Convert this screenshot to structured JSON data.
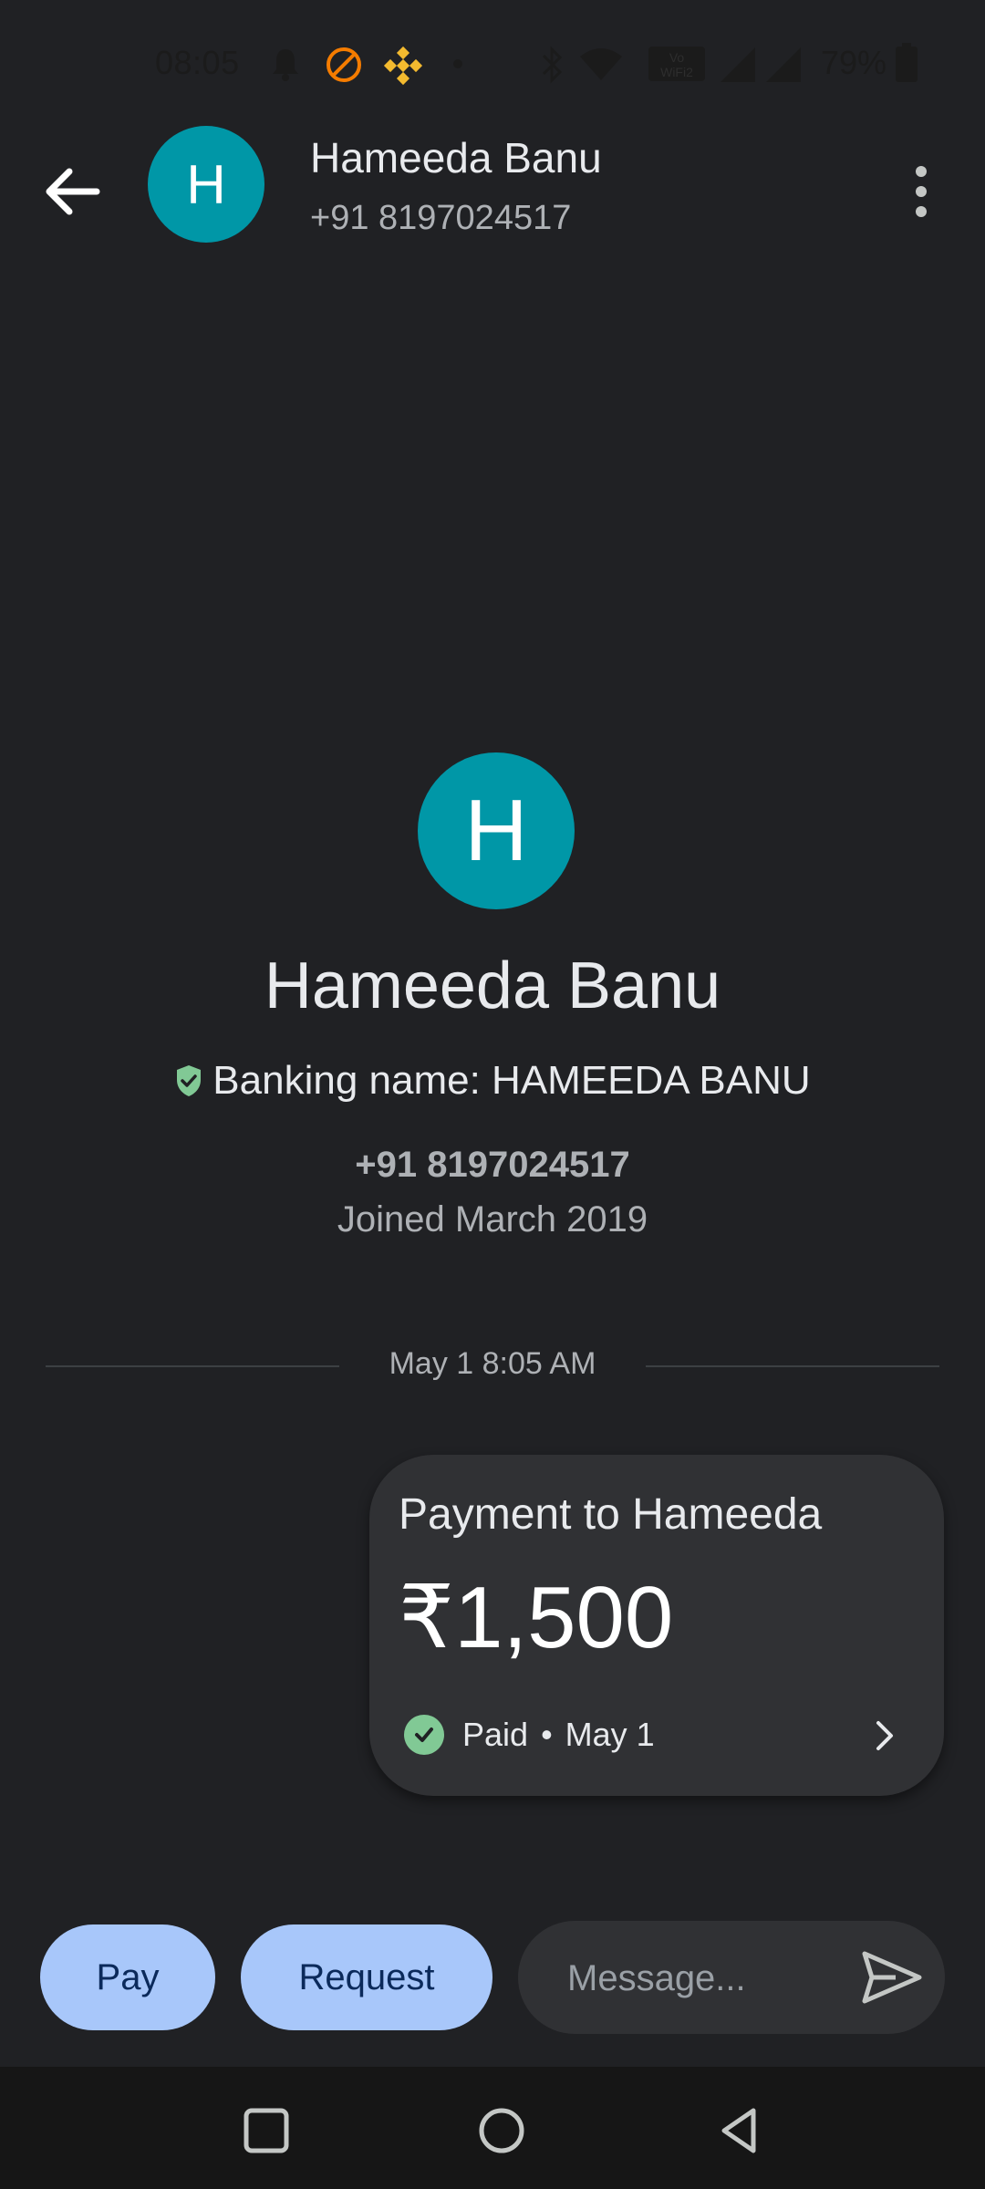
{
  "status_bar": {
    "time": "08:05",
    "battery_percent": "79%",
    "icons": [
      "bell-icon",
      "dnd-icon",
      "binance-icon",
      "dot-icon",
      "bluetooth-icon",
      "wifi-icon",
      "vowifi-icon",
      "signal-r-icon",
      "signal-icon",
      "battery-icon"
    ]
  },
  "header": {
    "avatar_initial": "H",
    "name": "Hameeda Banu",
    "phone": "+91 8197024517"
  },
  "profile": {
    "avatar_initial": "H",
    "name": "Hameeda Banu",
    "banking_name": "Banking name: HAMEEDA BANU",
    "phone": "+91 8197024517",
    "joined": "Joined March 2019"
  },
  "conversation": {
    "date_divider": "May 1 8:05 AM",
    "payment": {
      "title": "Payment to Hameeda",
      "amount": "₹1,500",
      "status": "Paid",
      "separator": "•",
      "date": "May 1"
    }
  },
  "actions": {
    "pay_label": "Pay",
    "request_label": "Request",
    "message_placeholder": "Message..."
  },
  "colors": {
    "background": "#202124",
    "avatar": "#0097a7",
    "card": "#303134",
    "pill": "#a8c7fa",
    "paid_check": "#81c995",
    "binance_yellow": "#f3ba2f",
    "dnd_orange": "#f57c00"
  }
}
